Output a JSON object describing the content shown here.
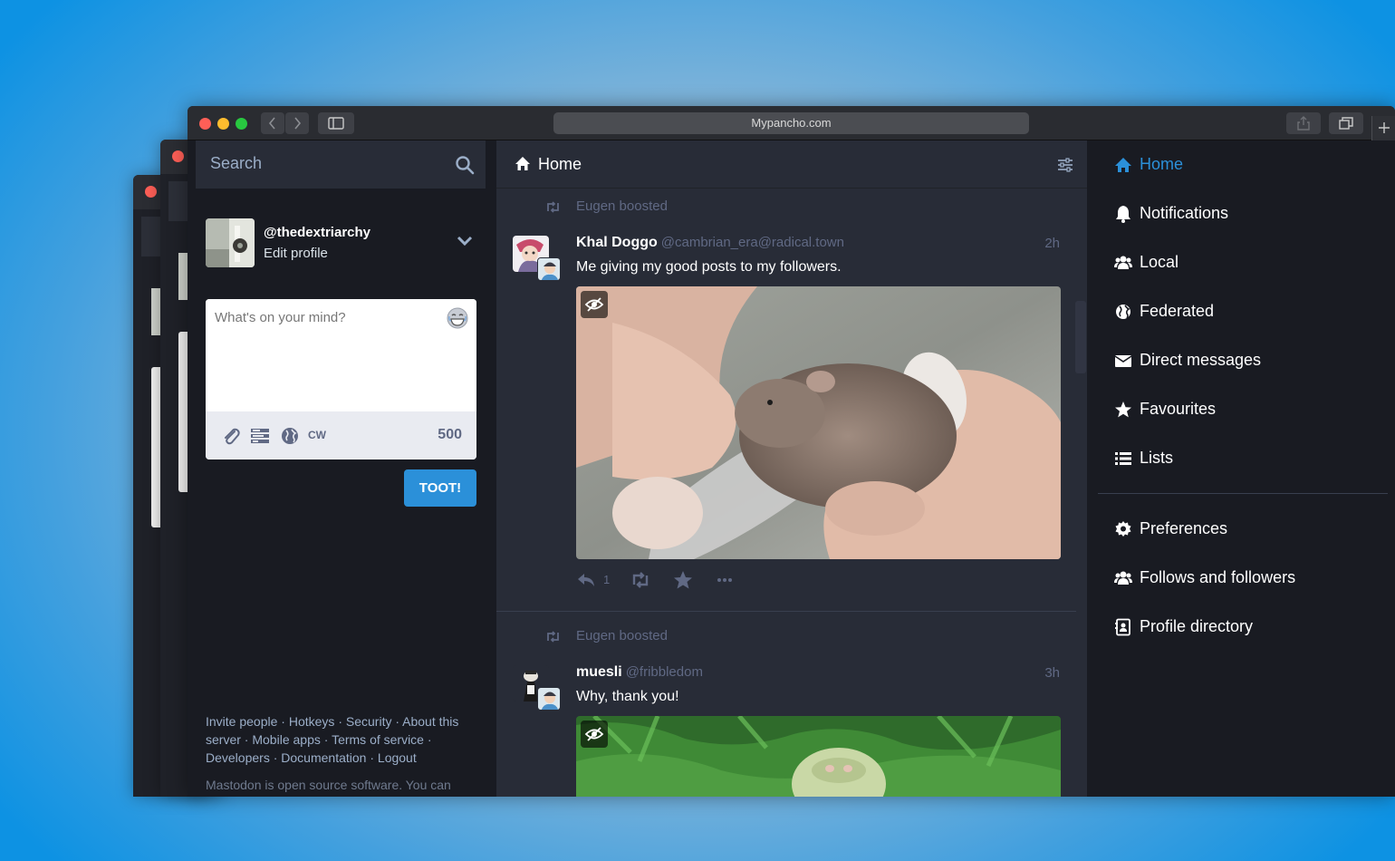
{
  "browser": {
    "url": "Mypancho.com"
  },
  "search": {
    "placeholder": "Search"
  },
  "account": {
    "handle": "@thedextriarchy",
    "edit_label": "Edit profile"
  },
  "compose": {
    "placeholder": "What's on your mind?",
    "cw_label": "CW",
    "char_count": "500",
    "submit_label": "TOOT!"
  },
  "footer": {
    "links": [
      "Invite people",
      "Hotkeys",
      "Security",
      "About this server",
      "Mobile apps",
      "Terms of service",
      "Developers",
      "Documentation",
      "Logout"
    ],
    "oss_text": "Mastodon is open source software. You can"
  },
  "timeline": {
    "title": "Home",
    "statuses": [
      {
        "boosted_by": "Eugen boosted",
        "display_name": "Khal Doggo",
        "acct": "@cambrian_era@radical.town",
        "time": "2h",
        "content": "Me giving my good posts to my followers.",
        "reply_count": "1"
      },
      {
        "boosted_by": "Eugen boosted",
        "display_name": "muesli",
        "acct": "@fribbledom",
        "time": "3h",
        "content": "Why, thank you!"
      }
    ]
  },
  "nav": {
    "items": [
      {
        "label": "Home",
        "icon": "home-icon",
        "active": true
      },
      {
        "label": "Notifications",
        "icon": "bell-icon"
      },
      {
        "label": "Local",
        "icon": "users-icon"
      },
      {
        "label": "Federated",
        "icon": "globe-icon"
      },
      {
        "label": "Direct messages",
        "icon": "envelope-icon"
      },
      {
        "label": "Favourites",
        "icon": "star-icon"
      },
      {
        "label": "Lists",
        "icon": "list-icon"
      }
    ],
    "secondary": [
      {
        "label": "Preferences",
        "icon": "gear-icon"
      },
      {
        "label": "Follows and followers",
        "icon": "users-icon"
      },
      {
        "label": "Profile directory",
        "icon": "address-book-icon"
      }
    ]
  },
  "colors": {
    "accent": "#2b90d9",
    "bg_dark": "#191b22",
    "bg_column": "#282c37",
    "muted": "#606984"
  }
}
